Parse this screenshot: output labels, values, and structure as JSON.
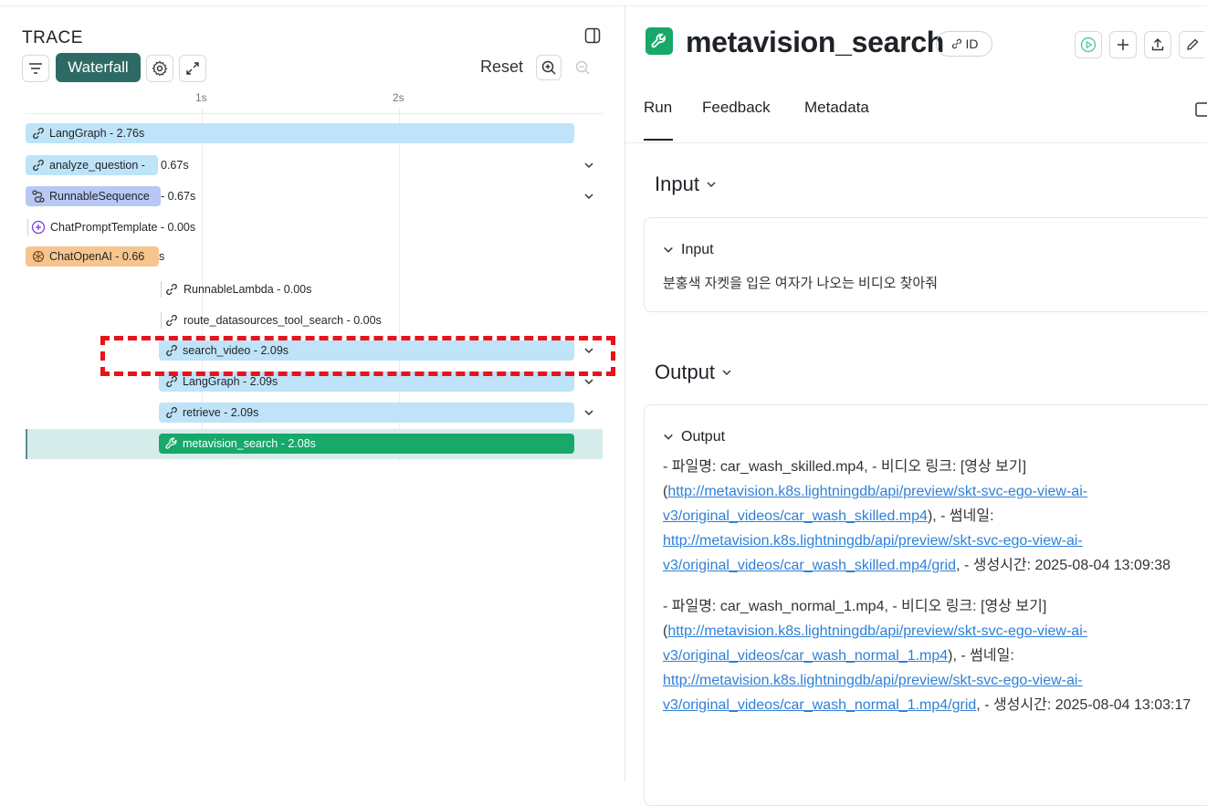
{
  "trace": {
    "title": "TRACE",
    "waterfall_label": "Waterfall",
    "reset_label": "Reset",
    "ticks": [
      "1s",
      "2s"
    ],
    "rows": [
      {
        "name": "LangGraph",
        "duration": "2.76s",
        "label": "LangGraph - 2.76s"
      },
      {
        "name": "analyze_question",
        "duration": "0.67s",
        "label_a": "analyze_question - ",
        "label_b": "0.67s"
      },
      {
        "name": "RunnableSequence",
        "duration": "0.67s",
        "label_a": "RunnableSequence",
        "label_b": " - 0.67s"
      },
      {
        "name": "ChatPromptTemplate",
        "duration": "0.00s",
        "label": "ChatPromptTemplate - 0.00s"
      },
      {
        "name": "ChatOpenAI",
        "duration": "0.66s",
        "label_a": "ChatOpenAI - 0.66",
        "label_b": "s"
      },
      {
        "name": "RunnableLambda",
        "duration": "0.00s",
        "label": "RunnableLambda - 0.00s"
      },
      {
        "name": "route_datasources_tool_search",
        "duration": "0.00s",
        "label": "route_datasources_tool_search - 0.00s"
      },
      {
        "name": "search_video",
        "duration": "2.09s",
        "label": "search_video - 2.09s"
      },
      {
        "name": "LangGraph",
        "duration": "2.09s",
        "label": "LangGraph - 2.09s"
      },
      {
        "name": "retrieve",
        "duration": "2.09s",
        "label": "retrieve - 2.09s"
      },
      {
        "name": "metavision_search",
        "duration": "2.08s",
        "label": "metavision_search - 2.08s"
      }
    ]
  },
  "detail": {
    "title": "metavision_search",
    "id_label": "ID",
    "tabs": [
      "Run",
      "Feedback",
      "Metadata"
    ],
    "input_section": "Input",
    "input_card_title": "Input",
    "input_text": "분홍색 자켓을 입은 여자가 나오는 비디오 찾아줘",
    "output_section": "Output",
    "output_card_title": "Output",
    "output_items": [
      {
        "prefix": "- 파일명: car_wash_skilled.mp4, - 비디오 링크: [영상 보기](",
        "link1": "http://metavision.k8s.lightningdb/api/preview/skt-svc-ego-view-ai-v3/original_videos/car_wash_skilled.mp4",
        "mid": "), - 썸네일: ",
        "link2": "http://metavision.k8s.lightningdb/api/preview/skt-svc-ego-view-ai-v3/original_videos/car_wash_skilled.mp4/grid",
        "suffix": ", - 생성시간: 2025-08-04 13:09:38"
      },
      {
        "prefix": "- 파일명: car_wash_normal_1.mp4, - 비디오 링크: [영상 보기](",
        "link1": "http://metavision.k8s.lightningdb/api/preview/skt-svc-ego-view-ai-v3/original_videos/car_wash_normal_1.mp4",
        "mid": "), - 썸네일: ",
        "link2": "http://metavision.k8s.lightningdb/api/preview/skt-svc-ego-view-ai-v3/original_videos/car_wash_normal_1.mp4/grid",
        "suffix": ", - 생성시간: 2025-08-04 13:03:17"
      }
    ]
  },
  "colors": {
    "accent": "#2d6a65",
    "tool_green": "#17a86a",
    "chain_blue": "#bfe3f8",
    "highlight_red": "#e8121a",
    "link": "#2f80d6"
  }
}
